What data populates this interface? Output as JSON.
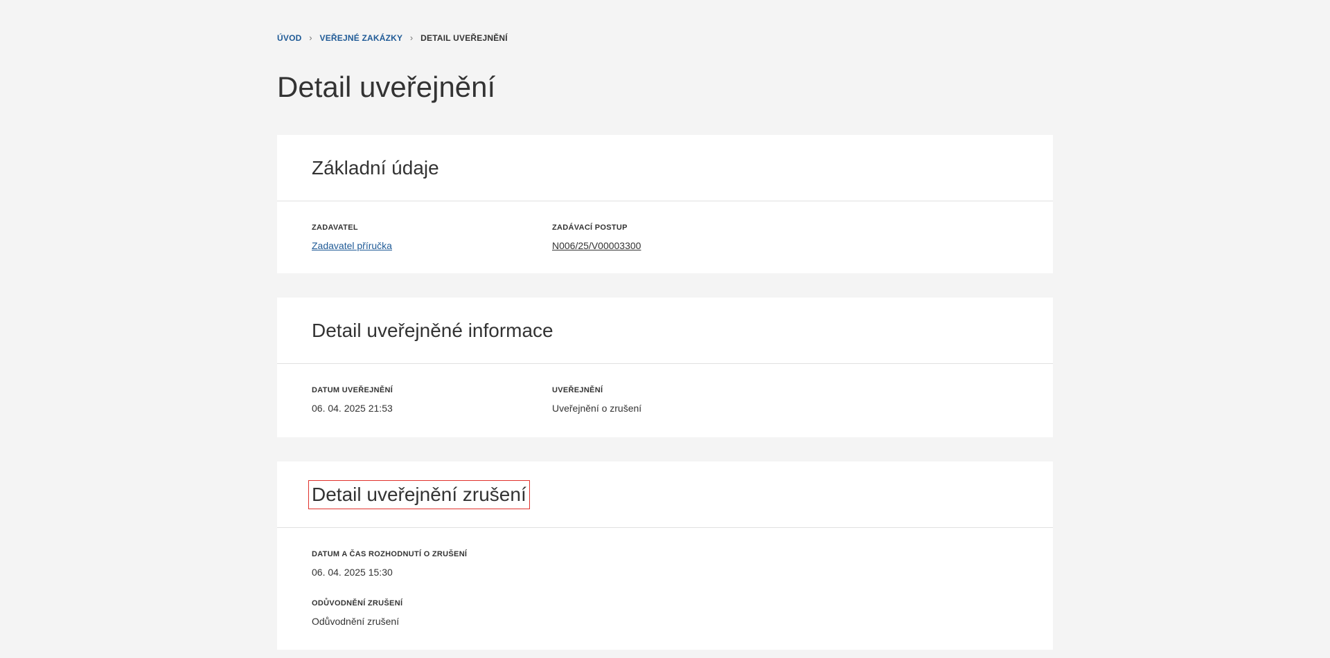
{
  "breadcrumb": {
    "items": [
      "ÚVOD",
      "VEŘEJNÉ ZAKÁZKY"
    ],
    "current": "DETAIL UVEŘEJNĚNÍ"
  },
  "page_title": "Detail uveřejnění",
  "basic_info": {
    "title": "Základní údaje",
    "contracting_authority_label": "ZADAVATEL",
    "contracting_authority_value": "Zadavatel příručka",
    "procedure_label": "ZADÁVACÍ POSTUP",
    "procedure_value": "N006/25/V00003300"
  },
  "published_info": {
    "title": "Detail uveřejněné informace",
    "date_label": "DATUM UVEŘEJNĚNÍ",
    "date_value": "06. 04. 2025 21:53",
    "publication_label": "UVEŘEJNĚNÍ",
    "publication_value": "Uveřejnění o zrušení"
  },
  "cancellation": {
    "title": "Detail uveřejnění zrušení",
    "decision_label": "DATUM A ČAS ROZHODNUTÍ O ZRUŠENÍ",
    "decision_value": "06. 04. 2025 15:30",
    "reason_label": "ODŮVODNĚNÍ ZRUŠENÍ",
    "reason_value": "Odůvodnění zrušení"
  },
  "colors": {
    "background": "#f4f4f4",
    "link": "#1f5a96",
    "highlight": "#e0302a"
  }
}
